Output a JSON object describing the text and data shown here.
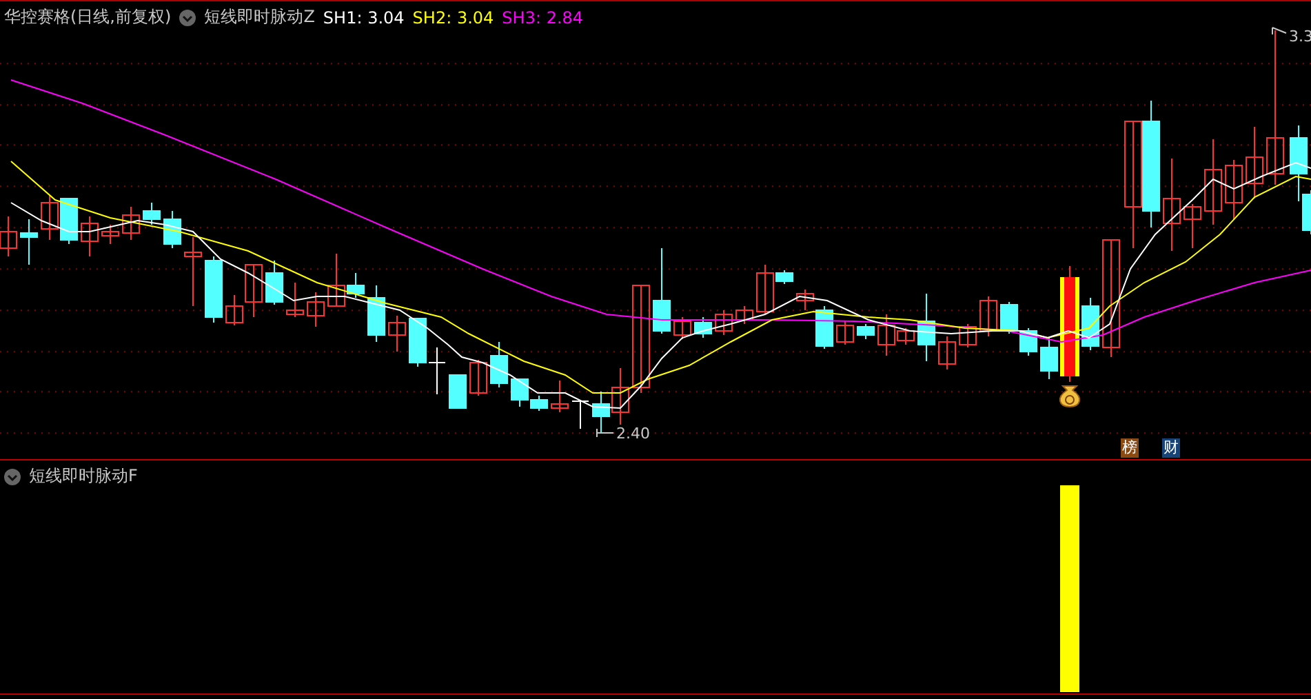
{
  "header": {
    "title": "华控赛格(日线,前复权)",
    "indicator": "短线即时脉动Z",
    "values": [
      {
        "label": "SH1:",
        "value": "3.04",
        "color": "#ffffff"
      },
      {
        "label": "SH2:",
        "value": "3.04",
        "color": "#ffff00"
      },
      {
        "label": "SH3:",
        "value": "2.84",
        "color": "#ff00ff"
      }
    ]
  },
  "price_labels": {
    "high": "3.3",
    "low": "2.40"
  },
  "badges": [
    {
      "text": "榜",
      "color": "#8a4a12"
    },
    {
      "text": "财",
      "color": "#174478"
    }
  ],
  "sub_panel": {
    "indicator": "短线即时脉动F"
  }
}
